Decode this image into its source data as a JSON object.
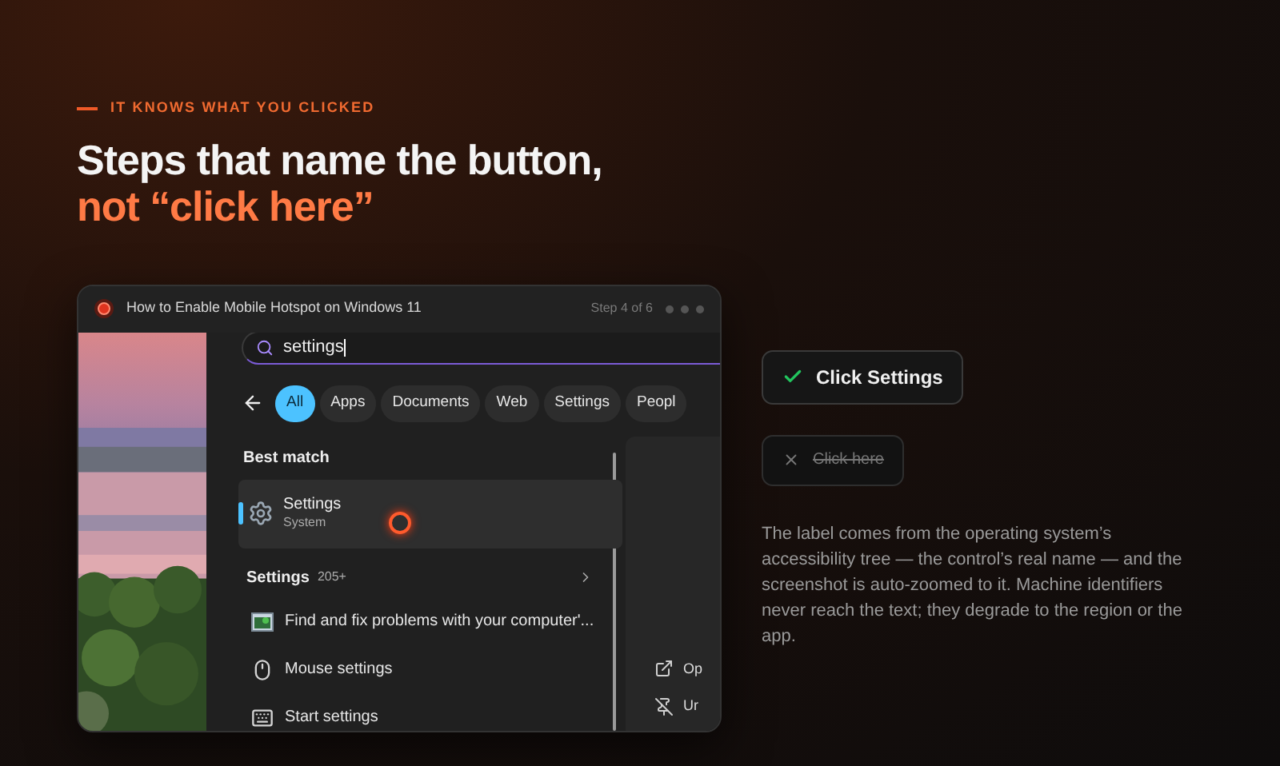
{
  "eyebrow": "IT KNOWS WHAT YOU CLICKED",
  "headline": "Steps that name the button,",
  "headline_accent": "not “click here”",
  "demo": {
    "title": "How to Enable Mobile Hotspot on Windows 11",
    "step": "Step 4 of 6",
    "search": {
      "value": "settings"
    },
    "filters": [
      {
        "label": "All",
        "selected": true
      },
      {
        "label": "Apps",
        "selected": false
      },
      {
        "label": "Documents",
        "selected": false
      },
      {
        "label": "Web",
        "selected": false
      },
      {
        "label": "Settings",
        "selected": false
      },
      {
        "label": "Peopl",
        "selected": false
      }
    ],
    "best_match_heading": "Best match",
    "best_match": {
      "title": "Settings",
      "subtitle": "System",
      "selected": true
    },
    "section": {
      "label": "Settings",
      "count": "205+"
    },
    "results": [
      {
        "kind": "troubleshoot",
        "label": "Find and fix problems with your computer'..."
      },
      {
        "kind": "mouse",
        "label": "Mouse settings"
      },
      {
        "kind": "start",
        "label": "Start settings"
      }
    ],
    "side_actions": [
      {
        "kind": "open",
        "label": "Op"
      },
      {
        "kind": "unpin",
        "label": "Ur"
      }
    ]
  },
  "examples": [
    {
      "kind": "good",
      "label": "Click Settings"
    },
    {
      "kind": "bad",
      "label": "Click here"
    }
  ],
  "note": "The label comes from the operating system’s accessibility tree — the control’s real name — and the screenshot is auto-zoomed to it. Machine identifiers never reach the text; they degrade to the region or the app."
}
